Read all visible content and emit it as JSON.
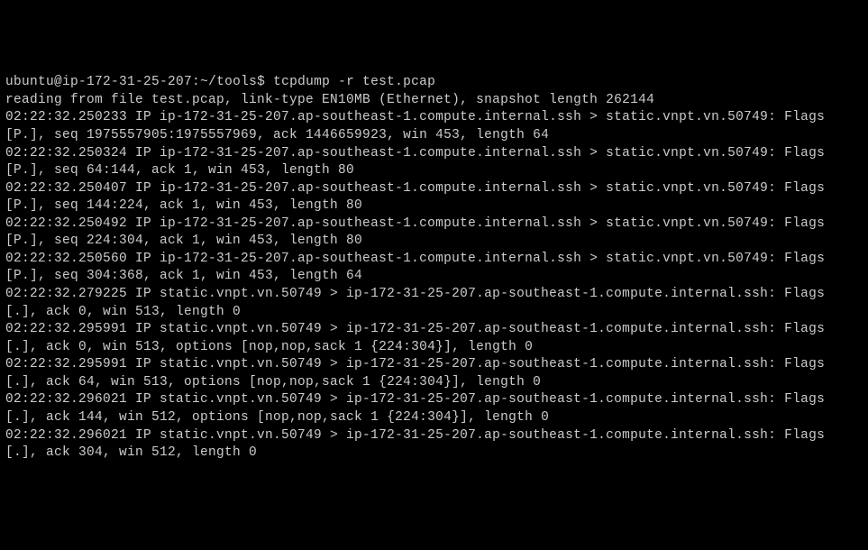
{
  "prompt": {
    "user_host": "ubuntu@ip-172-31-25-207",
    "path": "~/tools",
    "separator": "$",
    "command": "tcpdump -r test.pcap"
  },
  "lines": [
    "reading from file test.pcap, link-type EN10MB (Ethernet), snapshot length 262144",
    "02:22:32.250233 IP ip-172-31-25-207.ap-southeast-1.compute.internal.ssh > static.vnpt.vn.50749: Flags [P.], seq 1975557905:1975557969, ack 1446659923, win 453, length 64",
    "02:22:32.250324 IP ip-172-31-25-207.ap-southeast-1.compute.internal.ssh > static.vnpt.vn.50749: Flags [P.], seq 64:144, ack 1, win 453, length 80",
    "02:22:32.250407 IP ip-172-31-25-207.ap-southeast-1.compute.internal.ssh > static.vnpt.vn.50749: Flags [P.], seq 144:224, ack 1, win 453, length 80",
    "02:22:32.250492 IP ip-172-31-25-207.ap-southeast-1.compute.internal.ssh > static.vnpt.vn.50749: Flags [P.], seq 224:304, ack 1, win 453, length 80",
    "02:22:32.250560 IP ip-172-31-25-207.ap-southeast-1.compute.internal.ssh > static.vnpt.vn.50749: Flags [P.], seq 304:368, ack 1, win 453, length 64",
    "02:22:32.279225 IP static.vnpt.vn.50749 > ip-172-31-25-207.ap-southeast-1.compute.internal.ssh: Flags [.], ack 0, win 513, length 0",
    "02:22:32.295991 IP static.vnpt.vn.50749 > ip-172-31-25-207.ap-southeast-1.compute.internal.ssh: Flags [.], ack 0, win 513, options [nop,nop,sack 1 {224:304}], length 0",
    "02:22:32.295991 IP static.vnpt.vn.50749 > ip-172-31-25-207.ap-southeast-1.compute.internal.ssh: Flags [.], ack 64, win 513, options [nop,nop,sack 1 {224:304}], length 0",
    "02:22:32.296021 IP static.vnpt.vn.50749 > ip-172-31-25-207.ap-southeast-1.compute.internal.ssh: Flags [.], ack 144, win 512, options [nop,nop,sack 1 {224:304}], length 0",
    "02:22:32.296021 IP static.vnpt.vn.50749 > ip-172-31-25-207.ap-southeast-1.compute.internal.ssh: Flags [.], ack 304, win 512, length 0"
  ]
}
